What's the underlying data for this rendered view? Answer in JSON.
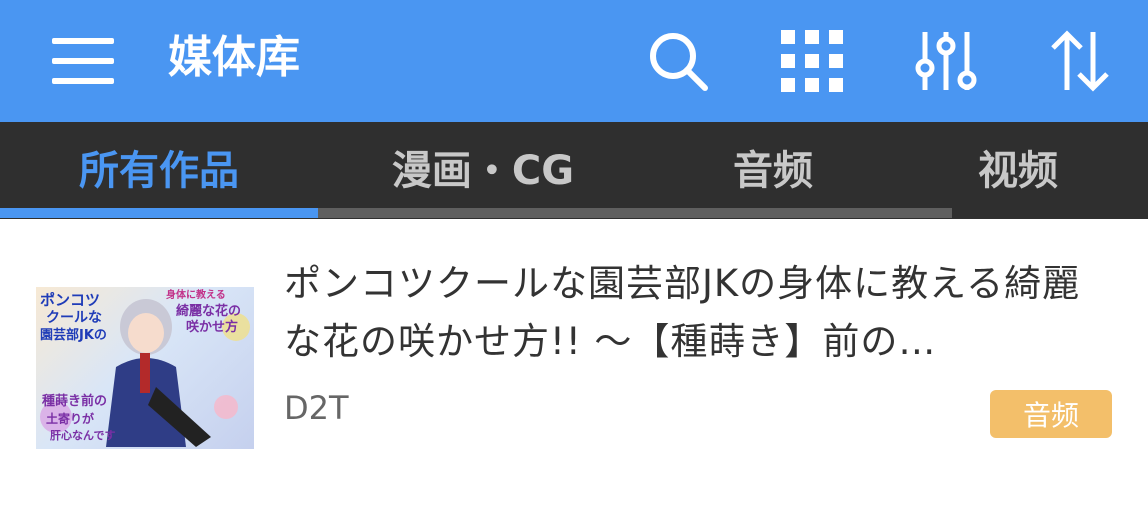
{
  "appbar": {
    "title": "媒体库",
    "icons": [
      "menu-icon",
      "search-icon",
      "grid-icon",
      "filter-sliders-icon",
      "sort-icon"
    ]
  },
  "tabs": [
    {
      "label": "所有作品",
      "active": true
    },
    {
      "label": "漫画・CG",
      "active": false
    },
    {
      "label": "音频",
      "active": false
    },
    {
      "label": "视频",
      "active": false
    }
  ],
  "works": [
    {
      "title": "ポンコツクールな園芸部JKの身体に教える綺麗な花の咲かせ方!! 〜【種蒔き】前の…",
      "circle": "D2T",
      "type_badge": "音频",
      "cover_text": [
        "ポンコツ",
        "クールな",
        "園芸部JKの",
        "身体に教える",
        "綺麗な花の",
        "咲かせ方",
        "種蒔き前の",
        "土寄りが",
        "肝心なんです"
      ]
    }
  ],
  "colors": {
    "appbar": "#4a96f2",
    "tabbar": "#2f2f2f",
    "active_tab": "#4a96f2",
    "inactive_tab": "#c8c8c8",
    "badge": "#f3bf6a"
  }
}
